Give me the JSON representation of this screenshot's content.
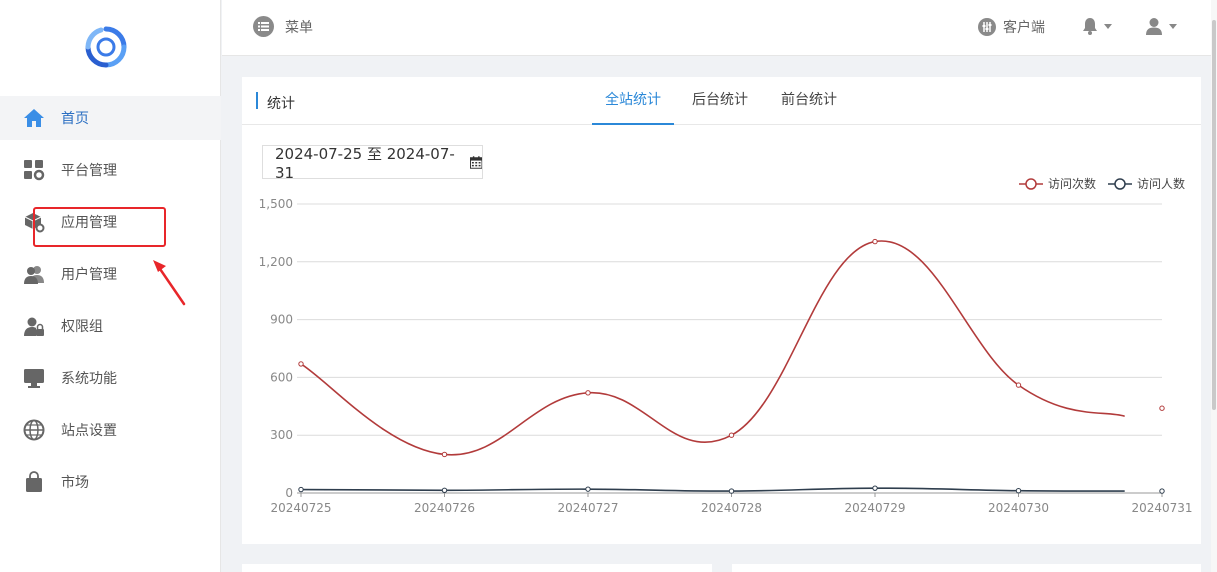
{
  "sidebar": {
    "items": [
      {
        "label": "首页",
        "icon": "home-icon",
        "active": true
      },
      {
        "label": "平台管理",
        "icon": "grid-gear-icon"
      },
      {
        "label": "应用管理",
        "icon": "box-gear-icon"
      },
      {
        "label": "用户管理",
        "icon": "users-icon"
      },
      {
        "label": "权限组",
        "icon": "user-lock-icon"
      },
      {
        "label": "系统功能",
        "icon": "monitor-icon"
      },
      {
        "label": "站点设置",
        "icon": "globe-icon"
      },
      {
        "label": "市场",
        "icon": "shopping-bag-icon"
      }
    ]
  },
  "topbar": {
    "menu_label": "菜单",
    "client_label": "客户端"
  },
  "card": {
    "title": "统计",
    "tabs": [
      {
        "label": "全站统计",
        "active": true
      },
      {
        "label": "后台统计"
      },
      {
        "label": "前台统计"
      }
    ],
    "date_range": "2024-07-25 至 2024-07-31"
  },
  "colors": {
    "accent": "#2b88d8",
    "visits": "#b23b3b",
    "visitors": "#2f3e4e",
    "annotation": "#e8262a"
  },
  "chart_data": {
    "type": "line",
    "categories": [
      "20240725",
      "20240726",
      "20240727",
      "20240728",
      "20240729",
      "20240730",
      "20240731"
    ],
    "series": [
      {
        "name": "访问次数",
        "values": [
          670,
          200,
          520,
          300,
          1305,
          560,
          440
        ]
      },
      {
        "name": "访问人数",
        "values": [
          18,
          14,
          20,
          10,
          25,
          12,
          10
        ]
      }
    ],
    "ylim": [
      0,
      1500
    ],
    "yticks": [
      "0",
      "300",
      "600",
      "900",
      "1,200",
      "1,500"
    ],
    "grid": true,
    "legend": "top-right",
    "smooth": true
  }
}
